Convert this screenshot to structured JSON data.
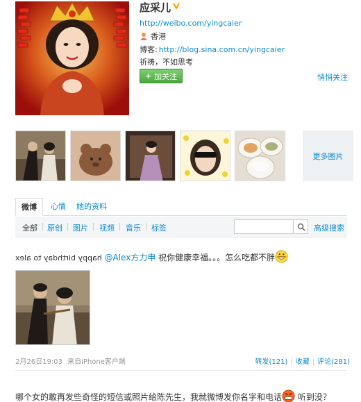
{
  "profile": {
    "name": "应采儿",
    "url": "http://weibo.com/yingcaier",
    "location": "香港",
    "blog_label": "博客:",
    "blog_url": "http://blog.sina.com.cn/yingcaier",
    "bio": "祈祷，不如思考",
    "follow_label": "加关注",
    "quiet_follow": "悄悄关注"
  },
  "photos": {
    "more_label": "更多图片"
  },
  "tabs": [
    {
      "label": "微博"
    },
    {
      "label": "心情"
    },
    {
      "label": "她的资料"
    }
  ],
  "filters": [
    {
      "label": "全部"
    },
    {
      "label": "原创"
    },
    {
      "label": "图片"
    },
    {
      "label": "视频"
    },
    {
      "label": "音乐"
    },
    {
      "label": "标签"
    }
  ],
  "search": {
    "placeholder": "",
    "advanced": "高级搜索"
  },
  "post1": {
    "mirrored_text": "happy birthday to alex",
    "mention": "@Alex方力申",
    "text": "祝你健康幸福。。。怎么吃都不胖",
    "time": "2月26日19:03",
    "source": "来自iPhone客户端",
    "repost": "转发(121)",
    "favorite": "收藏",
    "comment": "评论(281)"
  },
  "post2": {
    "text_before": "哪个女的敢再发些奇怪的短信或照片给陈先生，我就微博发你名字和电话",
    "text_after": "听到没？"
  },
  "colors": {
    "link": "#0a8cd2",
    "follow_green": "#4da63f"
  }
}
